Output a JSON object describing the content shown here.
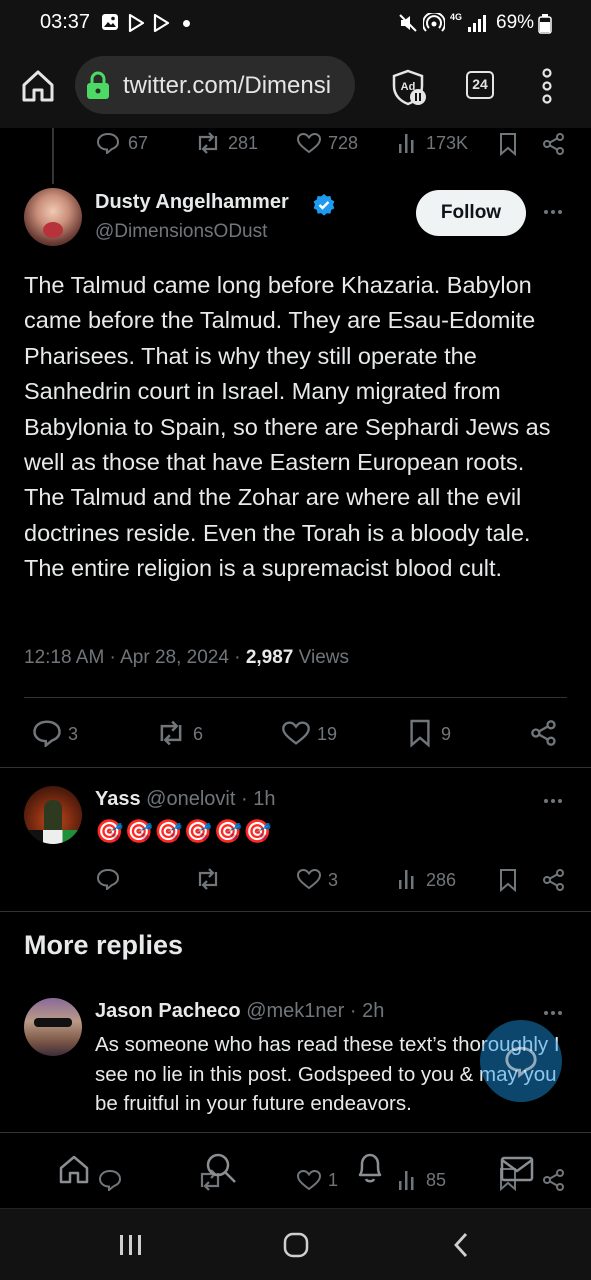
{
  "status": {
    "time": "03:37",
    "battery": "69%",
    "network": "4G"
  },
  "browser": {
    "url": "twitter.com/Dimensi",
    "tab_count": "24",
    "ad_label": "Ad"
  },
  "prev_tweet": {
    "replies": "67",
    "reposts": "281",
    "likes": "728",
    "views": "173K"
  },
  "main_tweet": {
    "author_name": "Dusty Angelhammer",
    "handle": "@DimensionsODust",
    "follow_label": "Follow",
    "text": "The Talmud came long before Khazaria. Babylon came before the Talmud.  They are Esau-Edomite Pharisees.  That is why they still operate the Sanhedrin court in Israel.  Many migrated from Babylonia to Spain, so there are Sephardi Jews as well as those that have Eastern European roots.  The Talmud and the Zohar are where all the evil doctrines reside.  Even the Torah is a bloody tale.  The entire religion is a supremacist blood cult.",
    "time": "12:18 AM",
    "date": "Apr 28, 2024",
    "views_count": "2,987",
    "views_label": "Views",
    "replies": "3",
    "reposts": "6",
    "likes": "19",
    "bookmarks": "9"
  },
  "reply_yass": {
    "author_name": "Yass",
    "handle": "@onelovit",
    "time": "1h",
    "text": "🎯🎯🎯🎯🎯🎯",
    "likes": "3",
    "views": "286"
  },
  "more_replies_heading": "More replies",
  "reply_jason": {
    "author_name": "Jason Pacheco",
    "handle": "@mek1ner",
    "time": "2h",
    "text": "As someone who has read these text’s thoroughly I see no lie in this post. Godspeed to you & may you be fruitful in your future endeavors.",
    "likes": "1",
    "views": "85"
  },
  "colors": {
    "accent": "#1d9bf0",
    "text": "#e7e9ea",
    "muted": "#71767b",
    "divider": "#2f3336",
    "lock_green": "#4cd964"
  }
}
